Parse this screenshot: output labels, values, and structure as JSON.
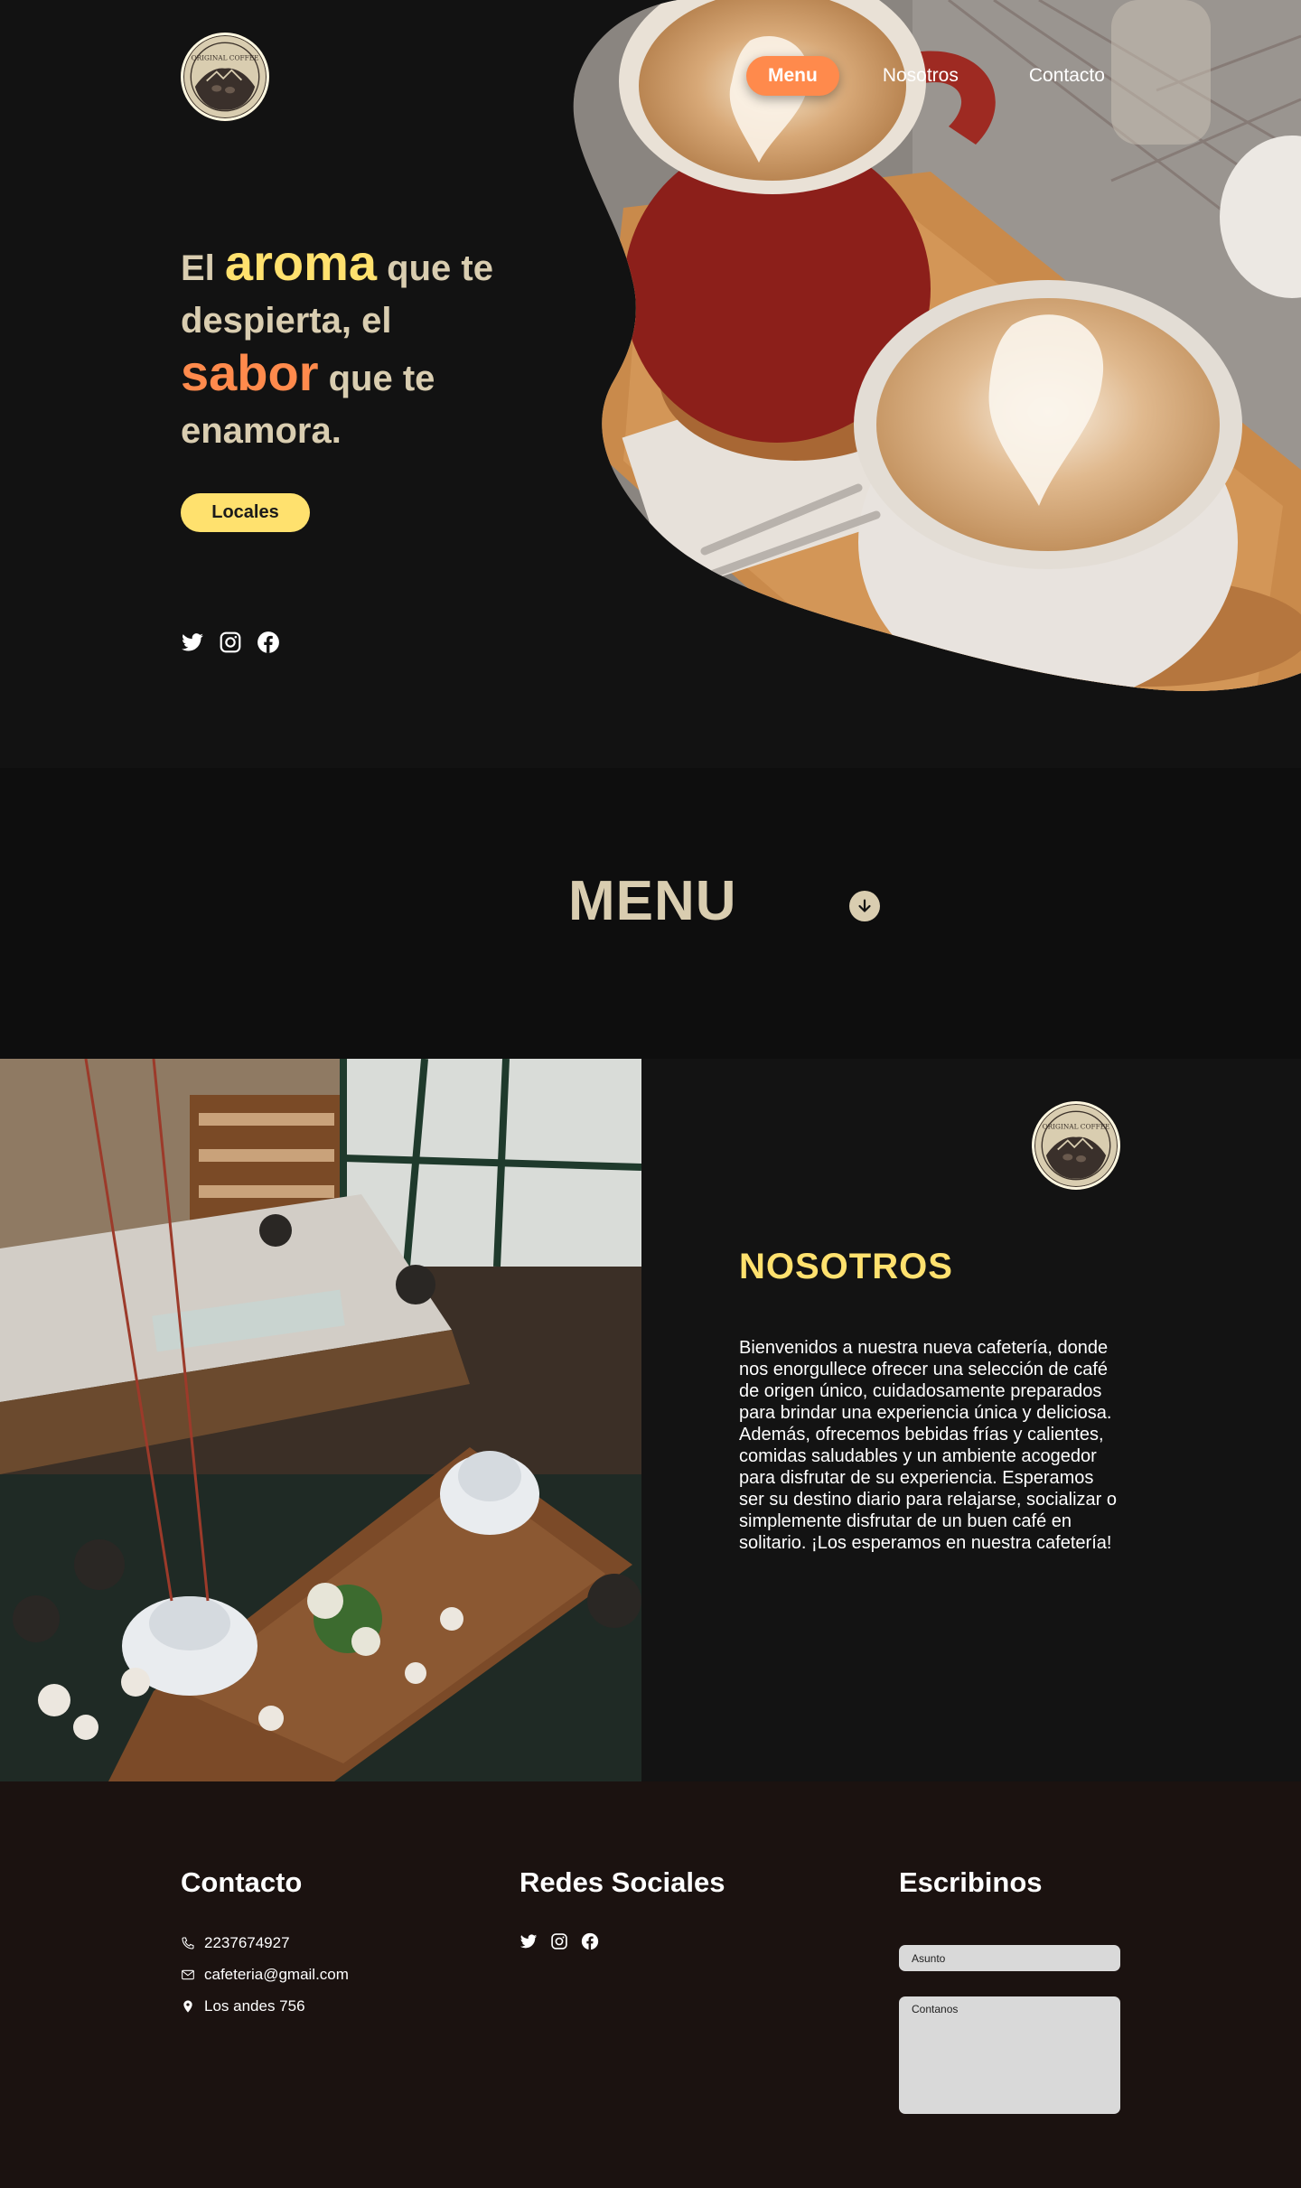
{
  "brand": {
    "logo_text": "ORIGINAL COFFEE"
  },
  "nav": {
    "menu": "Menu",
    "nosotros": "Nosotros",
    "contacto": "Contacto"
  },
  "hero": {
    "w1": "El",
    "w2": "aroma",
    "w3": "que te despierta, el",
    "w4": "sabor",
    "w5": "que te enamora.",
    "button": "Locales"
  },
  "menu_section": {
    "title": "MENU"
  },
  "nosotros": {
    "title": "NOSOTROS",
    "text": "Bienvenidos a nuestra nueva cafetería, donde nos enorgullece ofrecer una selección de café de origen único, cuidadosamente preparados para brindar una experiencia única y deliciosa. Además, ofrecemos bebidas frías y calientes, comidas saludables y un ambiente acogedor para disfrutar de su experiencia. Esperamos ser su destino diario para relajarse, socializar o simplemente disfrutar de un buen café en solitario. ¡Los esperamos en nuestra cafetería!"
  },
  "footer": {
    "contacto_title": "Contacto",
    "phone": "2237674927",
    "email": "cafeteria@gmail.com",
    "address": "Los andes 756",
    "redes_title": "Redes Sociales",
    "escribinos_title": "Escribinos",
    "asunto_placeholder": "Asunto",
    "contanos_placeholder": "Contanos"
  },
  "icons": [
    "twitter-icon",
    "instagram-icon",
    "facebook-icon",
    "phone-icon",
    "mail-icon",
    "location-icon",
    "arrow-down-icon"
  ],
  "colors": {
    "accent_orange": "#ff8a4c",
    "accent_yellow": "#ffe16e",
    "cream": "#d9cdb0",
    "background": "#121212",
    "footer_bg": "#1b1210"
  }
}
